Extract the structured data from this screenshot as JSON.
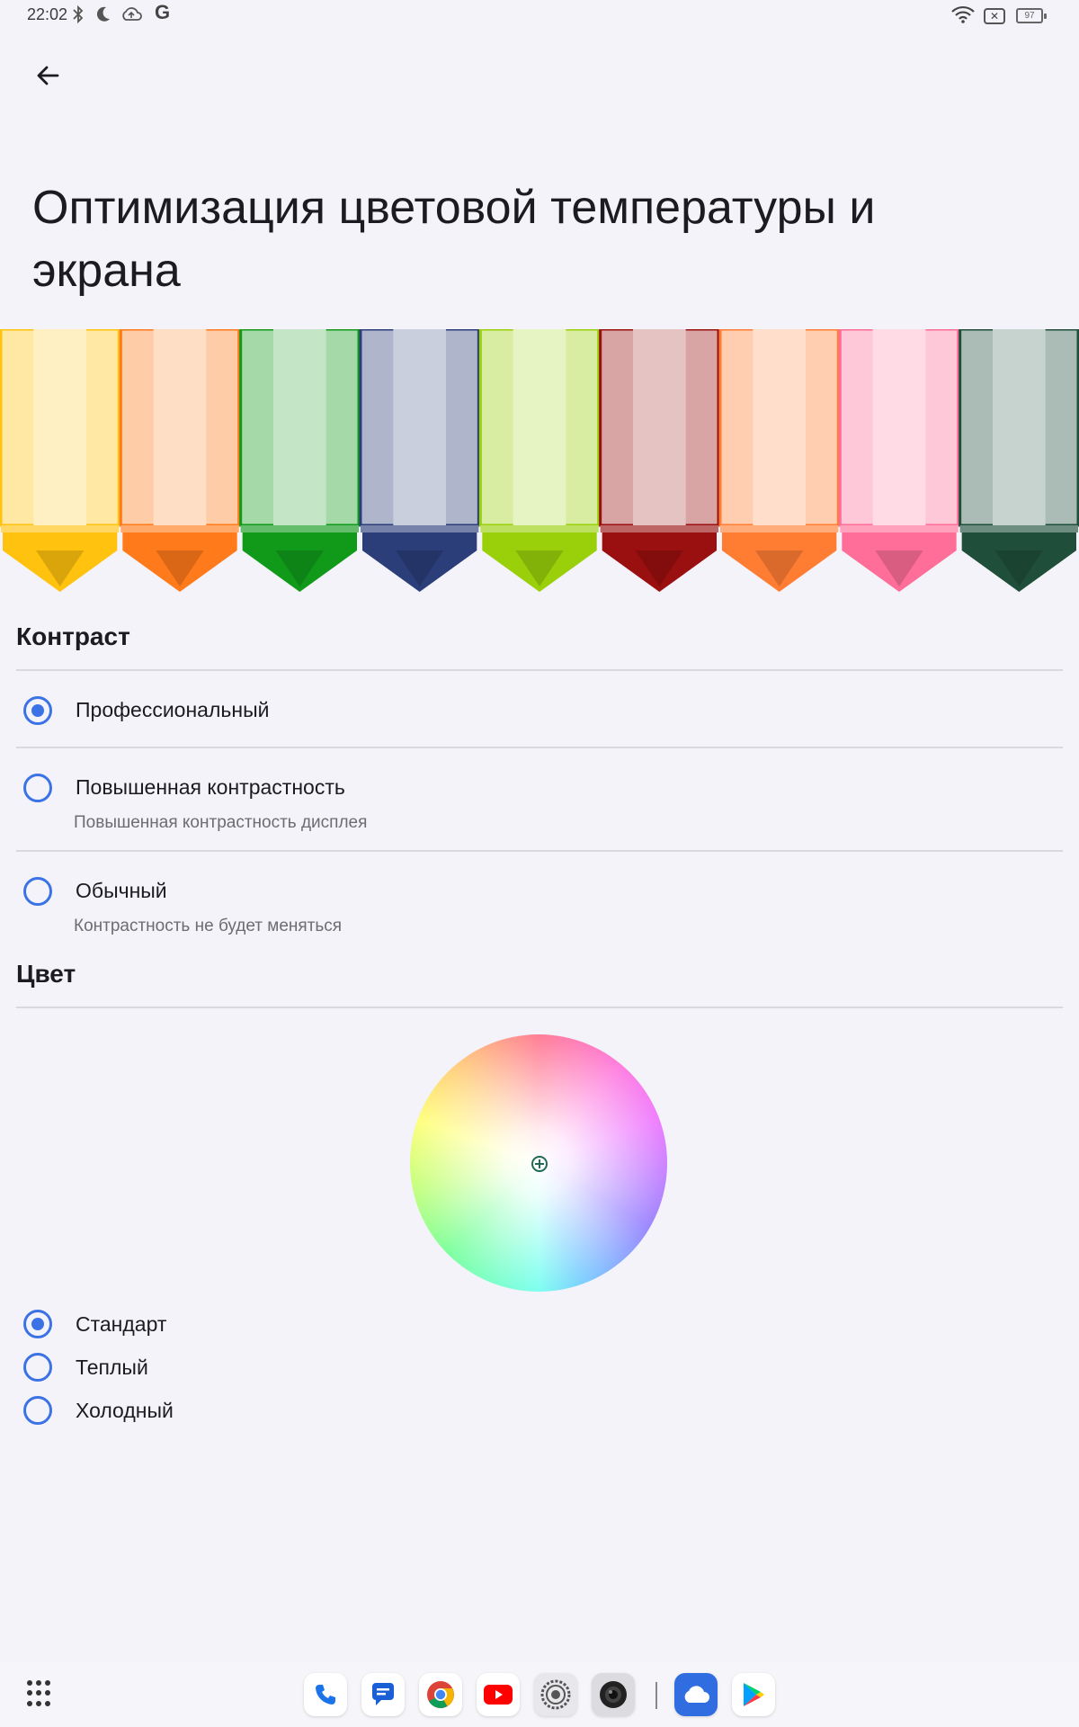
{
  "status_bar": {
    "time": "22:02",
    "battery": "97",
    "icons": [
      "bluetooth-icon",
      "do-not-disturb-icon",
      "cloud-upload-icon",
      "google-icon",
      "wifi-icon",
      "no-sim-icon",
      "battery-icon"
    ]
  },
  "header": {
    "title": "Оптимизация цветовой температуры и экрана"
  },
  "banner": {
    "crayon_colors": [
      "#ffc20e",
      "#ff7a1a",
      "#119a1a",
      "#2c3e7a",
      "#99d00a",
      "#9a1010",
      "#ff7d33",
      "#ff6e98",
      "#1f4f3b"
    ]
  },
  "contrast": {
    "section_title": "Контраст",
    "options": [
      {
        "label": "Профессиональный",
        "subtitle": "",
        "checked": true
      },
      {
        "label": "Повышенная контрастность",
        "subtitle": "Повышенная контрастность дисплея",
        "checked": false
      },
      {
        "label": "Обычный",
        "subtitle": "Контрастность не будет меняться",
        "checked": false
      }
    ]
  },
  "color": {
    "section_title": "Цвет",
    "options": [
      {
        "label": "Стандарт",
        "checked": true
      },
      {
        "label": "Теплый",
        "checked": false
      },
      {
        "label": "Холодный",
        "checked": false
      }
    ]
  },
  "dock": {
    "apps": [
      "phone-icon",
      "messages-icon",
      "chrome-icon",
      "youtube-icon",
      "settings-icon",
      "camera-icon",
      "cloud-icon",
      "play-store-icon"
    ]
  }
}
